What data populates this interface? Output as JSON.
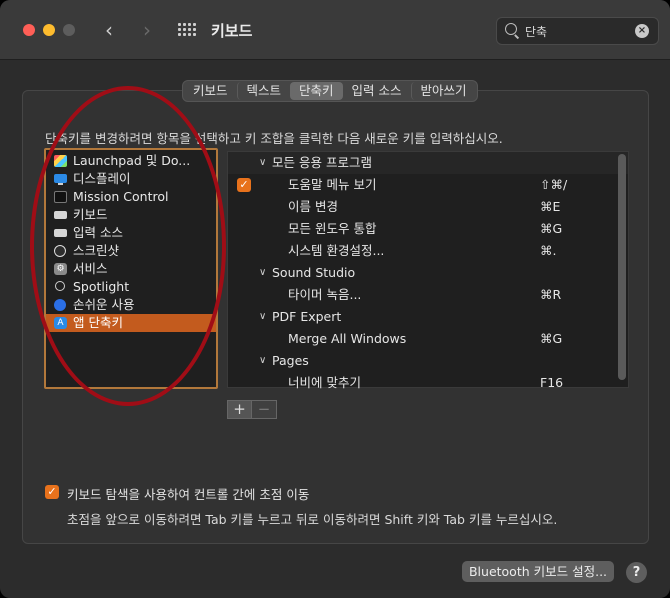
{
  "window": {
    "title": "키보드"
  },
  "search": {
    "value": "단축"
  },
  "tabs": [
    {
      "label": "키보드",
      "active": false
    },
    {
      "label": "텍스트",
      "active": false
    },
    {
      "label": "단축키",
      "active": true
    },
    {
      "label": "입력 소스",
      "active": false
    },
    {
      "label": "받아쓰기",
      "active": false
    }
  ],
  "instruction": "단축키를 변경하려면 항목을 선택하고 키 조합을 클릭한 다음 새로운 키를 입력하십시오.",
  "categories": [
    {
      "label": "Launchpad 및 Do...",
      "icon": "launchpad-icon"
    },
    {
      "label": "디스플레이",
      "icon": "display-icon"
    },
    {
      "label": "Mission Control",
      "icon": "mission-control-icon"
    },
    {
      "label": "키보드",
      "icon": "keyboard-icon"
    },
    {
      "label": "입력 소스",
      "icon": "input-source-icon"
    },
    {
      "label": "스크린샷",
      "icon": "screenshot-icon"
    },
    {
      "label": "서비스",
      "icon": "services-gear-icon"
    },
    {
      "label": "Spotlight",
      "icon": "spotlight-magnifier-icon"
    },
    {
      "label": "손쉬운 사용",
      "icon": "accessibility-icon"
    },
    {
      "label": "앱 단축키",
      "icon": "app-store-icon",
      "selected": true
    }
  ],
  "shortcuts": {
    "groups": [
      {
        "name": "모든 응용 프로그램",
        "items": [
          {
            "name": "도움말 메뉴 보기",
            "keys": "⇧⌘/",
            "checked": true
          },
          {
            "name": "이름 변경",
            "keys": "⌘E"
          },
          {
            "name": "모든 윈도우 통합",
            "keys": "⌘G"
          },
          {
            "name": "시스템 환경설정...",
            "keys": "⌘."
          }
        ]
      },
      {
        "name": "Sound Studio",
        "items": [
          {
            "name": "타이머 녹음...",
            "keys": "⌘R"
          }
        ]
      },
      {
        "name": "PDF Expert",
        "items": [
          {
            "name": "Merge All Windows",
            "keys": "⌘G"
          }
        ]
      },
      {
        "name": "Pages",
        "items": [
          {
            "name": "너비에 맞추기",
            "keys": "F16"
          }
        ]
      }
    ]
  },
  "buttons": {
    "add": "+",
    "remove": "−",
    "bluetooth": "Bluetooth 키보드 설정...",
    "help": "?"
  },
  "keyboard_navigation": {
    "checked": true,
    "label": "키보드 탐색을 사용하여 컨트롤 간에 초점 이동",
    "hint": "초점을 앞으로 이동하려면 Tab 키를 누르고 뒤로 이동하려면 Shift 키와 Tab 키를 누르십시오."
  },
  "colors": {
    "accent": "#e8721c",
    "selection": "#c35b1e",
    "annotation": "#a00d16"
  }
}
